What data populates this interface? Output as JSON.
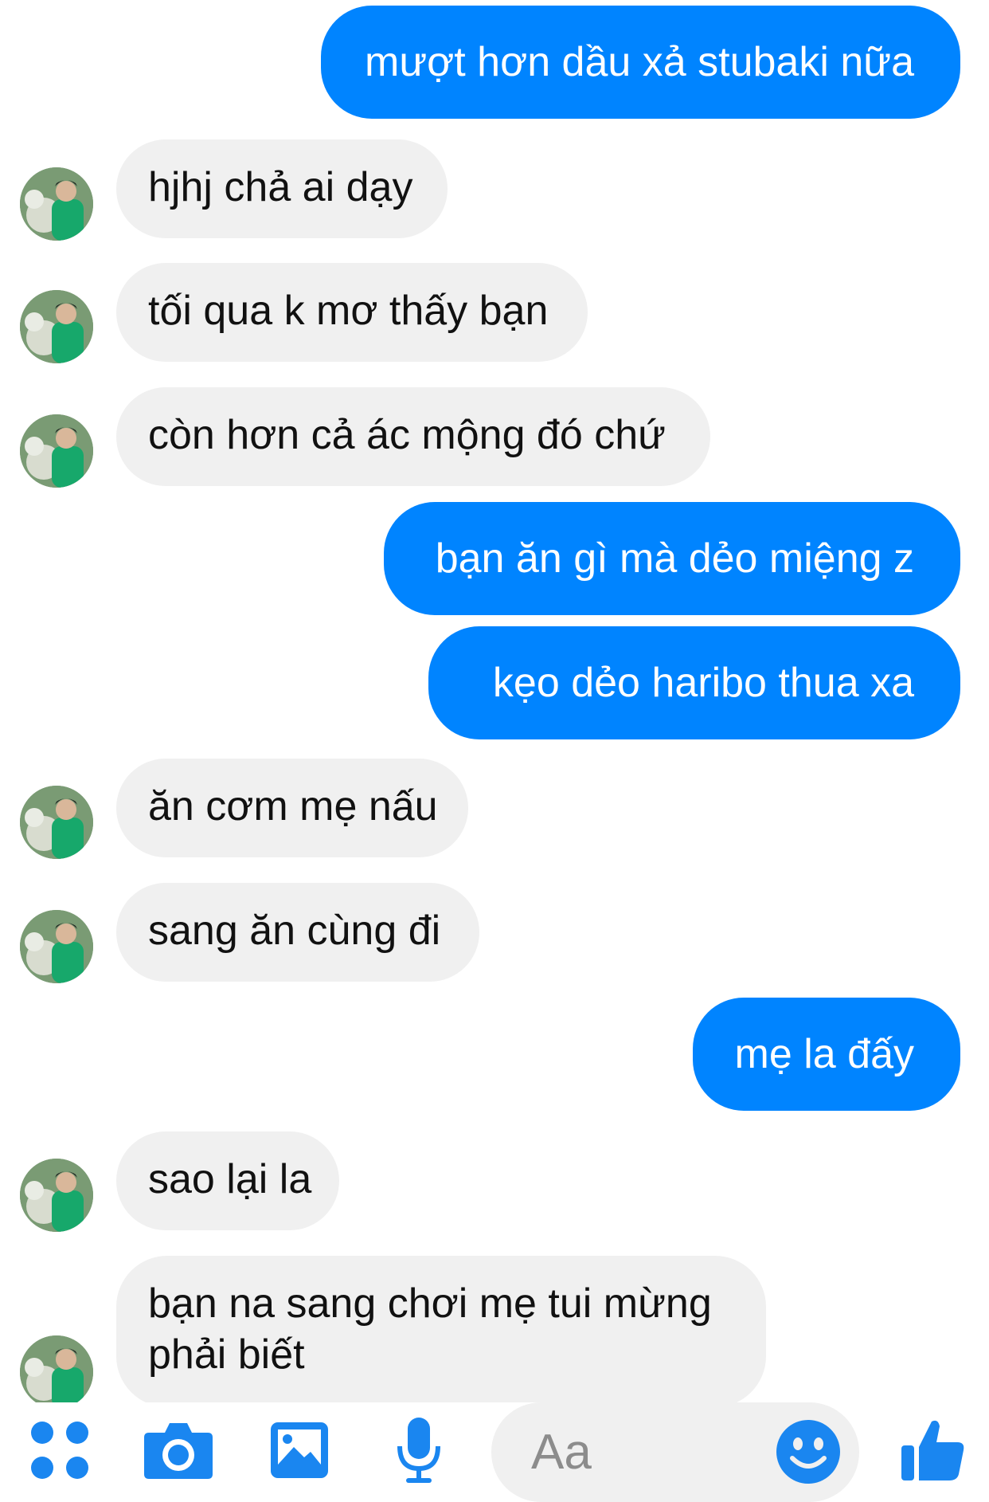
{
  "messages": [
    {
      "side": "out",
      "text": "mượt hơn dầu xả stubaki nữa"
    },
    {
      "side": "in",
      "text": "hjhj chả ai dạy"
    },
    {
      "side": "in",
      "text": "tối qua k mơ thấy bạn"
    },
    {
      "side": "in",
      "text": "còn hơn cả ác mộng đó chứ"
    },
    {
      "side": "out",
      "text": "bạn ăn gì mà dẻo miệng z"
    },
    {
      "side": "out",
      "text": "kẹo dẻo haribo thua xa"
    },
    {
      "side": "in",
      "text": "ăn cơm mẹ nấu"
    },
    {
      "side": "in",
      "text": "sang ăn cùng đi"
    },
    {
      "side": "out",
      "text": "mẹ la đấy"
    },
    {
      "side": "in",
      "text": "sao lại la"
    },
    {
      "side": "in",
      "text": "bạn na sang chơi mẹ tui mừng phải biết"
    }
  ],
  "composer": {
    "placeholder": "Aa",
    "icons": [
      "menu-dots-icon",
      "camera-icon",
      "gallery-icon",
      "microphone-icon",
      "emoji-icon",
      "like-icon"
    ]
  },
  "colors": {
    "outgoing_bubble": "#0084ff",
    "incoming_bubble": "#f0f0f0",
    "accent": "#0084ff",
    "icon_blue": "#1a86f0"
  }
}
